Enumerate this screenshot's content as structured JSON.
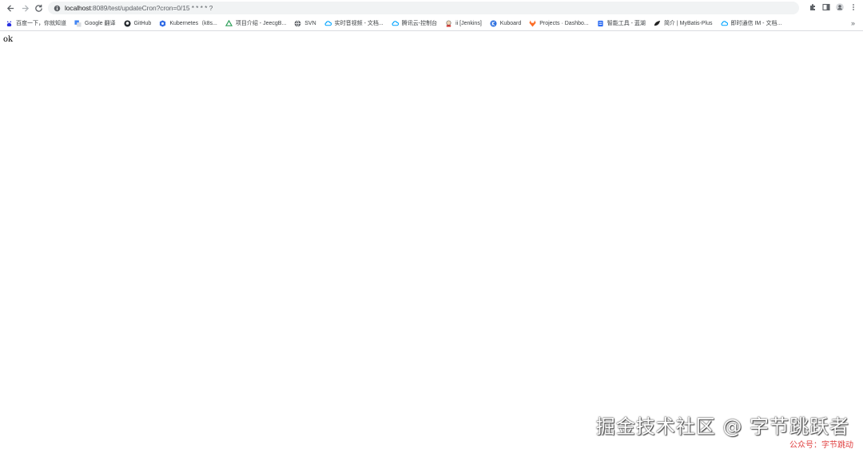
{
  "browser": {
    "url_host": "localhost",
    "url_rest": ":8089/test/updateCron?cron=0/15 * * * * ?",
    "bookmarks": [
      {
        "label": "百度一下，你就知道",
        "icon": "baidu-icon",
        "color": "#2932e1"
      },
      {
        "label": "Google 翻译",
        "icon": "google-translate-icon",
        "color": "#4285f4"
      },
      {
        "label": "GitHub",
        "icon": "github-icon",
        "color": "#24292e"
      },
      {
        "label": "Kubernetes（k8s...",
        "icon": "kubernetes-icon",
        "color": "#326ce5"
      },
      {
        "label": "项目介绍 - JeecgB...",
        "icon": "jeecg-icon",
        "color": "#2e9f5a"
      },
      {
        "label": "SVN",
        "icon": "globe-icon",
        "color": "#5f6368"
      },
      {
        "label": "实时音视频 - 文档...",
        "icon": "tencent-cloud-icon",
        "color": "#00a4ff"
      },
      {
        "label": "腾讯云-控制台",
        "icon": "tencent-cloud-icon",
        "color": "#00a4ff"
      },
      {
        "label": "ii [Jenkins]",
        "icon": "jenkins-icon",
        "color": "#d33833"
      },
      {
        "label": "Kuboard",
        "icon": "kuboard-icon",
        "color": "#3072e0"
      },
      {
        "label": "Projects · Dashbo...",
        "icon": "gitlab-icon",
        "color": "#fc6d26"
      },
      {
        "label": "智能工具 - 蓝湖",
        "icon": "lanhu-icon",
        "color": "#2f6ef3"
      },
      {
        "label": "简介 | MyBatis-Plus",
        "icon": "mybatis-icon",
        "color": "#222222"
      },
      {
        "label": "即时通信 IM - 文档...",
        "icon": "tencent-cloud-icon",
        "color": "#00a4ff"
      }
    ],
    "more_bookmarks": "»"
  },
  "page": {
    "body_text": "ok"
  },
  "watermark": {
    "main": "掘金技术社区 @ 字节跳跃者",
    "sub": "公众号：字节跳动"
  }
}
